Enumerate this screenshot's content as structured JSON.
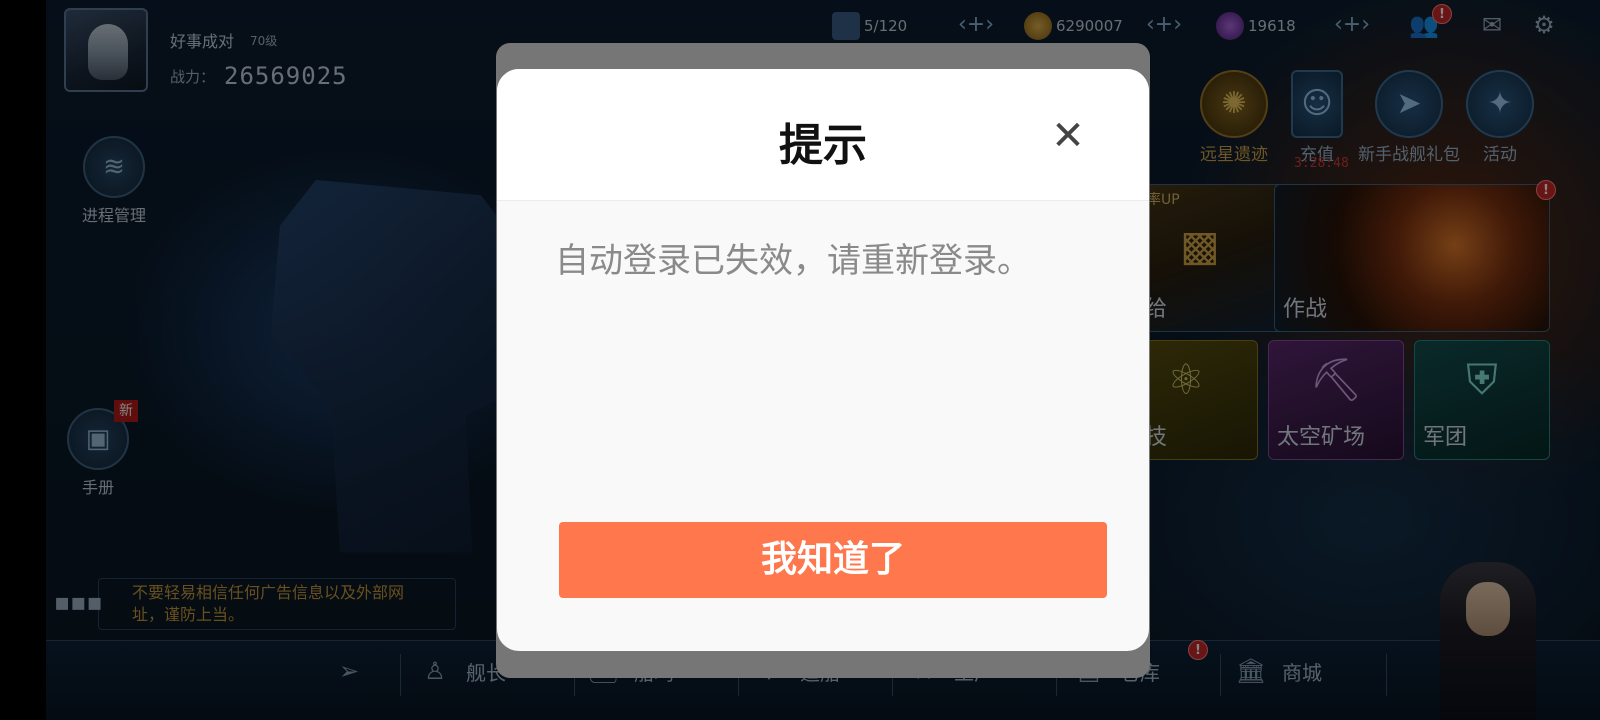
{
  "player": {
    "name": "好事成对",
    "level": "70级",
    "power_label": "战力：",
    "power_value": "26569025"
  },
  "resources": [
    {
      "id": "cargo",
      "icon": "crate-icon",
      "value": "5/120"
    },
    {
      "id": "gold",
      "icon": "coin-icon",
      "value": "6290007"
    },
    {
      "id": "gems",
      "icon": "crystal-icon",
      "value": "19618"
    }
  ],
  "top_icons": {
    "friends_badge": "!"
  },
  "left_menu": {
    "process": "进程管理",
    "manual": "手册",
    "new_tag": "新"
  },
  "notice": "不要轻易相信任何广告信息以及外部网址，谨防上当。",
  "right_menu": [
    {
      "label": "远星遗迹"
    },
    {
      "label": "充值"
    },
    {
      "label": "新手战舰礼包"
    },
    {
      "label": "活动"
    }
  ],
  "timer": "3:28:48",
  "tiles": {
    "rate_up": "概率UP",
    "supply": "补给",
    "battle": "作战",
    "tech": "科技",
    "mining": "太空矿场",
    "legion": "军团"
  },
  "bottom_nav": [
    "舰长",
    "船坞",
    "造船",
    "工厂",
    "仓库",
    "商城"
  ],
  "dialog": {
    "title": "提示",
    "message": "自动登录已失效，请重新登录。",
    "confirm": "我知道了"
  },
  "colors": {
    "confirm_button": "#ff774c",
    "dialog_bg": "#f9f9f9",
    "notice_text": "#c89a3a",
    "timer": "#d23a3a"
  }
}
